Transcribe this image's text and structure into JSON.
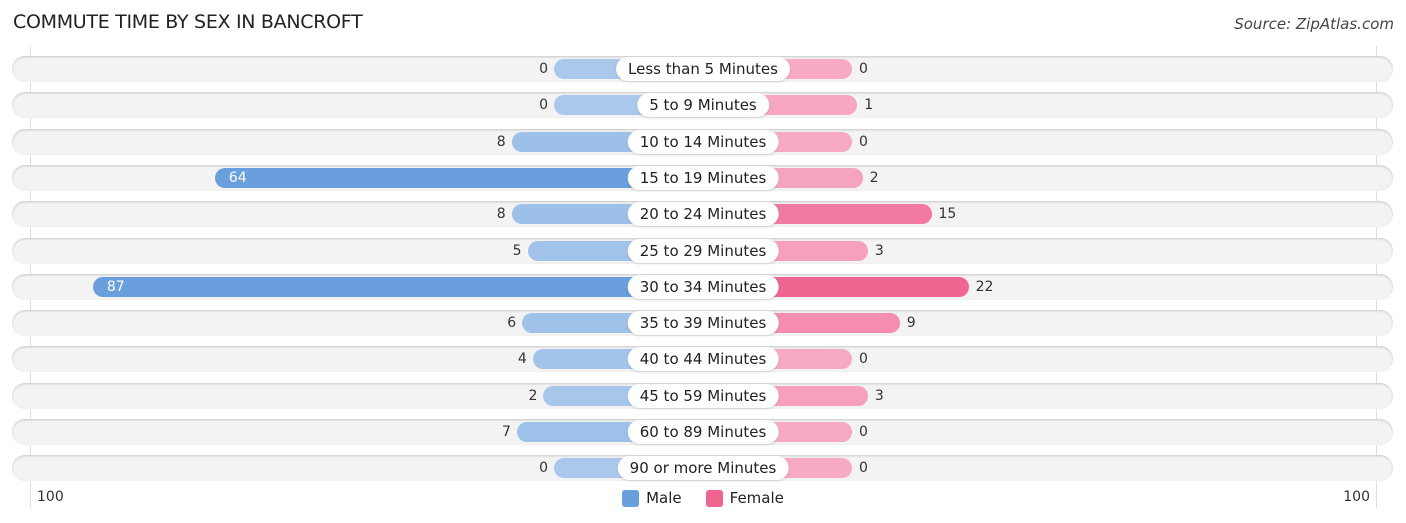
{
  "chart_data": {
    "type": "bar",
    "orientation": "horizontal-diverging",
    "title": "COMMUTE TIME BY SEX IN BANCROFT",
    "source": "Source: ZipAtlas.com",
    "categories": [
      "Less than 5 Minutes",
      "5 to 9 Minutes",
      "10 to 14 Minutes",
      "15 to 19 Minutes",
      "20 to 24 Minutes",
      "25 to 29 Minutes",
      "30 to 34 Minutes",
      "35 to 39 Minutes",
      "40 to 44 Minutes",
      "45 to 59 Minutes",
      "60 to 89 Minutes",
      "90 or more Minutes"
    ],
    "series": [
      {
        "name": "Male",
        "values": [
          0,
          0,
          8,
          64,
          8,
          5,
          87,
          6,
          4,
          2,
          7,
          0
        ],
        "color": "#6a9fdd"
      },
      {
        "name": "Female",
        "values": [
          0,
          1,
          0,
          2,
          15,
          3,
          22,
          9,
          0,
          3,
          0,
          0
        ],
        "color": "#f06490"
      }
    ],
    "axis": {
      "left_tick": "100",
      "right_tick": "100",
      "range": [
        0,
        100
      ]
    },
    "legend": {
      "position": "bottom-center",
      "items": [
        "Male",
        "Female"
      ]
    }
  }
}
